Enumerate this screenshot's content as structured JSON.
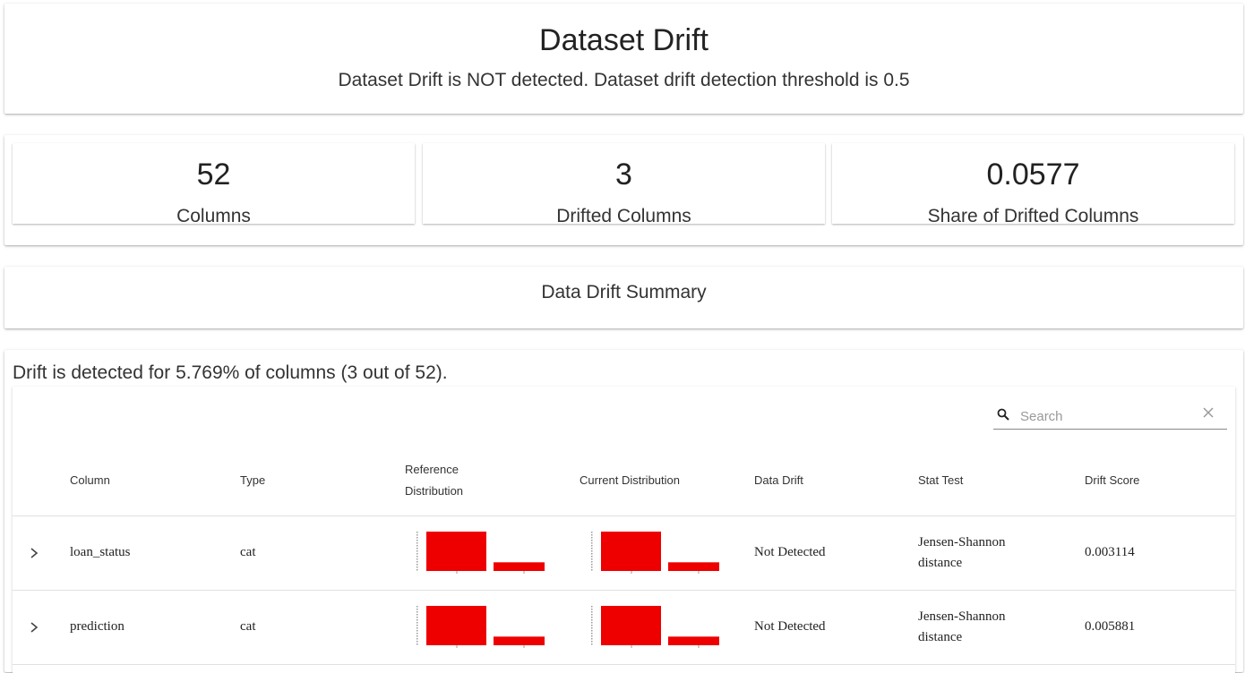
{
  "header": {
    "title": "Dataset Drift",
    "subtitle": "Dataset Drift is NOT detected. Dataset drift detection threshold is 0.5"
  },
  "counters": [
    {
      "value": "52",
      "label": "Columns"
    },
    {
      "value": "3",
      "label": "Drifted Columns"
    },
    {
      "value": "0.0577",
      "label": "Share of Drifted Columns"
    }
  ],
  "summary": {
    "title": "Data Drift Summary",
    "drift_text": "Drift is detected for 5.769% of columns (3 out of 52)."
  },
  "search": {
    "placeholder": "Search",
    "value": ""
  },
  "table": {
    "headers": {
      "column": "Column",
      "type": "Type",
      "reference": "Reference Distribution",
      "current": "Current Distribution",
      "data_drift": "Data Drift",
      "stat_test": "Stat Test",
      "drift_score": "Drift Score"
    },
    "rows": [
      {
        "column": "loan_status",
        "type": "cat",
        "data_drift": "Not Detected",
        "stat_test": "Jensen-Shannon distance",
        "drift_score": "0.003114",
        "reference_bars": [
          1.0,
          0.22
        ],
        "current_bars": [
          1.0,
          0.22
        ]
      },
      {
        "column": "prediction",
        "type": "cat",
        "data_drift": "Not Detected",
        "stat_test": "Jensen-Shannon distance",
        "drift_score": "0.005881",
        "reference_bars": [
          1.0,
          0.22
        ],
        "current_bars": [
          1.0,
          0.22
        ]
      }
    ]
  },
  "colors": {
    "bar": "#ee0000",
    "text": "#222222"
  },
  "icons": {
    "search": "search-icon",
    "clear": "close-icon",
    "expand": "chevron-right-icon"
  }
}
